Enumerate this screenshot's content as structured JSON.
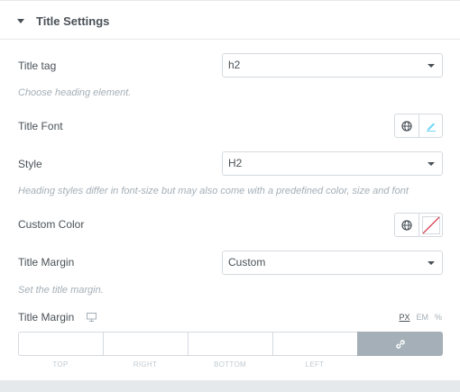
{
  "section": {
    "title": "Title Settings"
  },
  "title_tag": {
    "label": "Title tag",
    "value": "h2",
    "description": "Choose heading element."
  },
  "title_font": {
    "label": "Title Font"
  },
  "style": {
    "label": "Style",
    "value": "H2",
    "description": "Heading styles differ in font-size but may also come with a predefined color, size and font"
  },
  "custom_color": {
    "label": "Custom Color"
  },
  "title_margin_type": {
    "label": "Title Margin",
    "value": "Custom",
    "description": "Set the title margin."
  },
  "title_margin_dims": {
    "label": "Title Margin",
    "units": [
      "PX",
      "EM",
      "%"
    ],
    "active_unit": "PX",
    "fields": [
      "TOP",
      "RIGHT",
      "BOTTOM",
      "LEFT"
    ]
  },
  "icons": {
    "caret": "caret-down-icon",
    "globe": "globe-icon",
    "edit": "pencil-icon",
    "no_color": "no-color-swatch-icon",
    "desktop": "desktop-icon",
    "link": "link-icon"
  },
  "colors": {
    "accent": "#71d7f7",
    "error": "#d72b3f",
    "link_button": "#a4afb7"
  }
}
